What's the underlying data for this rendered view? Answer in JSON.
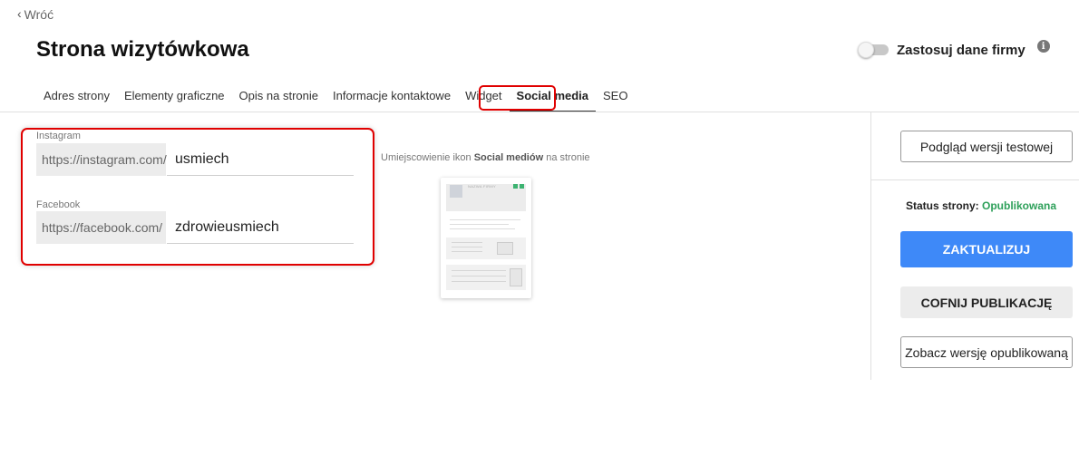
{
  "nav": {
    "back_label": "Wróć"
  },
  "header": {
    "title": "Strona wizytówkowa",
    "toggle_label": "Zastosuj dane firmy",
    "toggle_on": false
  },
  "tabs": [
    {
      "label": "Adres strony"
    },
    {
      "label": "Elementy graficzne"
    },
    {
      "label": "Opis na stronie"
    },
    {
      "label": "Informacje kontaktowe"
    },
    {
      "label": "Widget"
    },
    {
      "label": "Social media",
      "active": true
    },
    {
      "label": "SEO"
    }
  ],
  "social": {
    "instagram": {
      "label": "Instagram",
      "prefix": "https://instagram.com/",
      "value": "usmiech"
    },
    "facebook": {
      "label": "Facebook",
      "prefix": "https://facebook.com/",
      "value": "zdrowieusmiech"
    }
  },
  "placement": {
    "text_before": "Umiejscowienie ikon ",
    "text_bold": "Social mediów",
    "text_after": " na stronie",
    "preview_company_name": "NAZWA FIRMY"
  },
  "sidebar": {
    "preview_button": "Podgląd wersji testowej",
    "status_label": "Status strony:",
    "status_value": "Opublikowana",
    "update_button": "ZAKTUALIZUJ",
    "unpublish_button": "COFNIJ PUBLIKACJĘ",
    "view_published_button": "Zobacz wersję opublikowaną"
  },
  "colors": {
    "accent_blue": "#3e89f8",
    "status_green": "#2ea05a",
    "highlight_red": "#e00000"
  }
}
